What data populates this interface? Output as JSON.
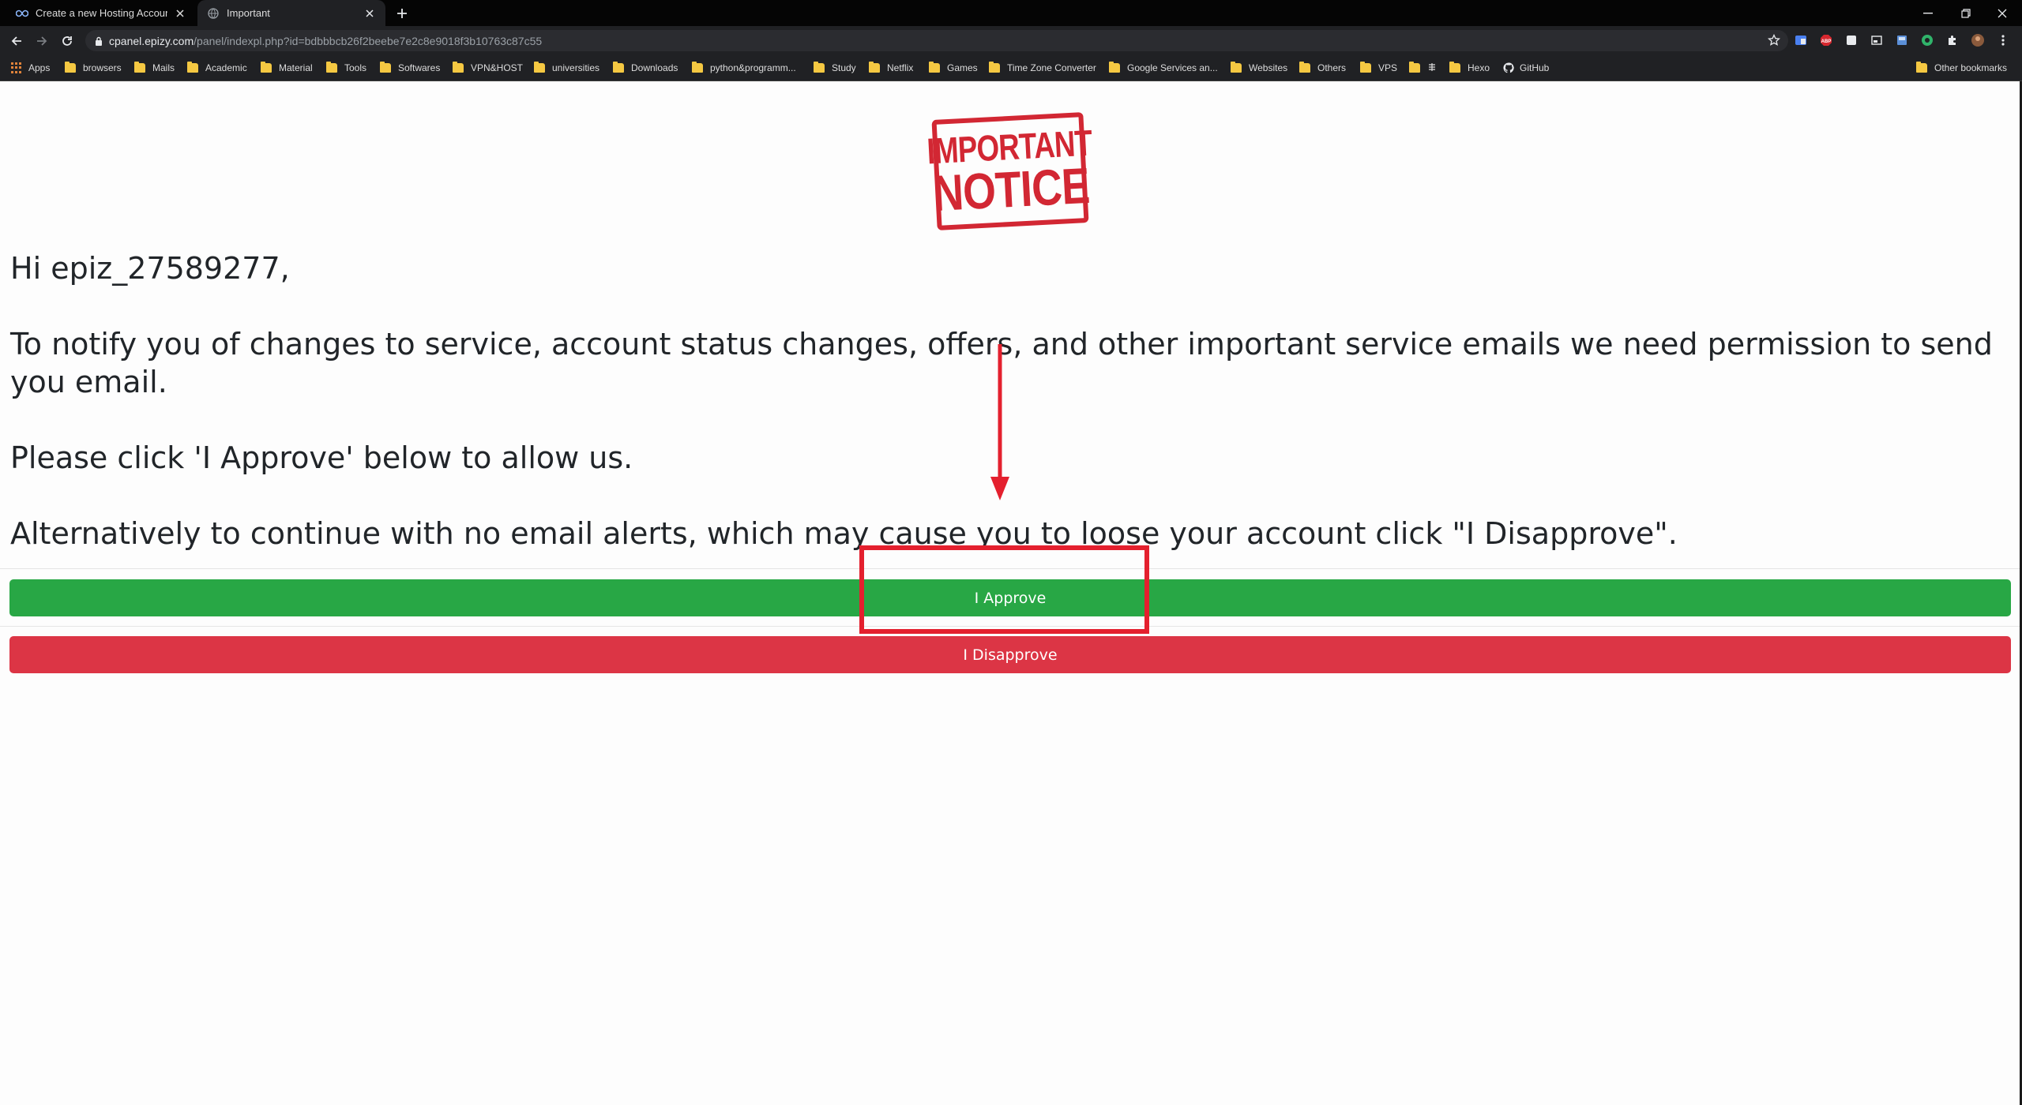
{
  "tabs": [
    {
      "title": "Create a new Hosting Account - ",
      "active": false
    },
    {
      "title": "Important",
      "active": true
    }
  ],
  "address": {
    "host": "cpanel.epizy.com",
    "path": "/panel/indexpl.php?id=bdbbbcb26f2beebe7e2c8e9018f3b10763c87c55"
  },
  "bookmarks": {
    "apps": "Apps",
    "folders": [
      "browsers",
      "Mails",
      "Academic",
      "Material",
      "Tools",
      "Softwares",
      "VPN&HOST",
      "universities",
      "Downloads",
      "python&programm...",
      "Study",
      "Netflix",
      "Games",
      "Time Zone Converter",
      "Google Services an...",
      "Websites",
      "Others",
      "VPS"
    ],
    "hexo": "Hexo",
    "github": "GitHub",
    "other": "Other bookmarks"
  },
  "notice": {
    "line1": "IMPORTANT",
    "line2": "NOTICE"
  },
  "message": {
    "greeting": "Hi epiz_27589277,",
    "para1": "To notify you of changes to service, account status changes, offers, and other important service emails we need permission to send you email.",
    "para2": "Please click 'I Approve' below to allow us.",
    "para3": "Alternatively to continue with no email alerts, which may cause you to loose your account click \"I Disapprove\"."
  },
  "buttons": {
    "approve": "I Approve",
    "disapprove": "I Disapprove"
  },
  "colors": {
    "approve": "#28a745",
    "disapprove": "#dc3545",
    "annotation": "#e4202e",
    "stamp": "#d22733"
  },
  "icons": [
    "infinity-icon",
    "globe-icon",
    "close-icon",
    "plus-icon",
    "minimize-icon",
    "restore-icon",
    "back-icon",
    "forward-icon",
    "reload-icon",
    "lock-icon",
    "star-icon",
    "github-icon",
    "folder-icon",
    "puzzle-icon",
    "kebab-menu-icon"
  ]
}
